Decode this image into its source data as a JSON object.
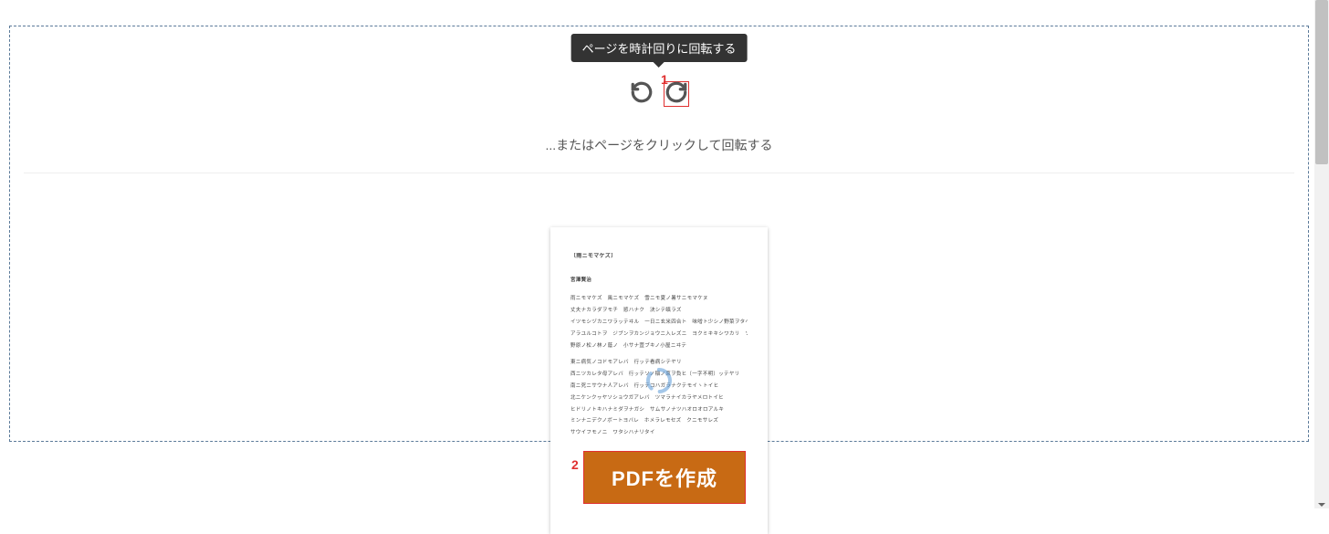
{
  "tooltip": {
    "text": "ページを時計回りに回転する"
  },
  "hint": {
    "text": "...またはページをクリックして回転する"
  },
  "markers": {
    "one": "1",
    "two": "2"
  },
  "create_button": {
    "label": "PDFを作成"
  },
  "document_preview": {
    "title": "〔雨ニモマケズ〕",
    "author": "宮澤賢治",
    "lines": [
      "雨ニモマケズ　風ニモマケズ　雪ニモ夏ノ暑サニモマケヌ",
      "丈夫ナカラダヲモチ　慾ハナク　決シテ瞋ラズ",
      "イツモシヅカニワラッテヰル　一日ニ玄米四合ト　味噌ト少シノ野菜ヲタベ",
      "アラユルコトヲ　ジブンヲカンジョウニ入レズニ　ヨクミキキシワカリ　ソシテワスレズ",
      "野原ノ松ノ林ノ蔭ノ　小サナ萓ブキノ小屋ニヰテ",
      "",
      "東ニ病気ノコドモアレバ　行ッテ看病シテヤリ",
      "西ニツカレタ母アレバ　行ッテソノ稲ノ朿ヲ負ヒ〔一字不明〕ッテヤリ",
      "南ニ死ニサウナ人アレバ　行ッテコハガラナクテモイヽトイヒ",
      "北ニケンクヮヤソショウガアレバ　ツマラナイカラヤメロトイヒ",
      "ヒドリノトキハナミダヲナガシ　サムサノナツハオロオロアルキ",
      "ミンナニデクノボートヨバレ　ホメラレモセズ　クニモサレズ",
      "サウイフモノニ　ワタシハナリタイ"
    ]
  }
}
